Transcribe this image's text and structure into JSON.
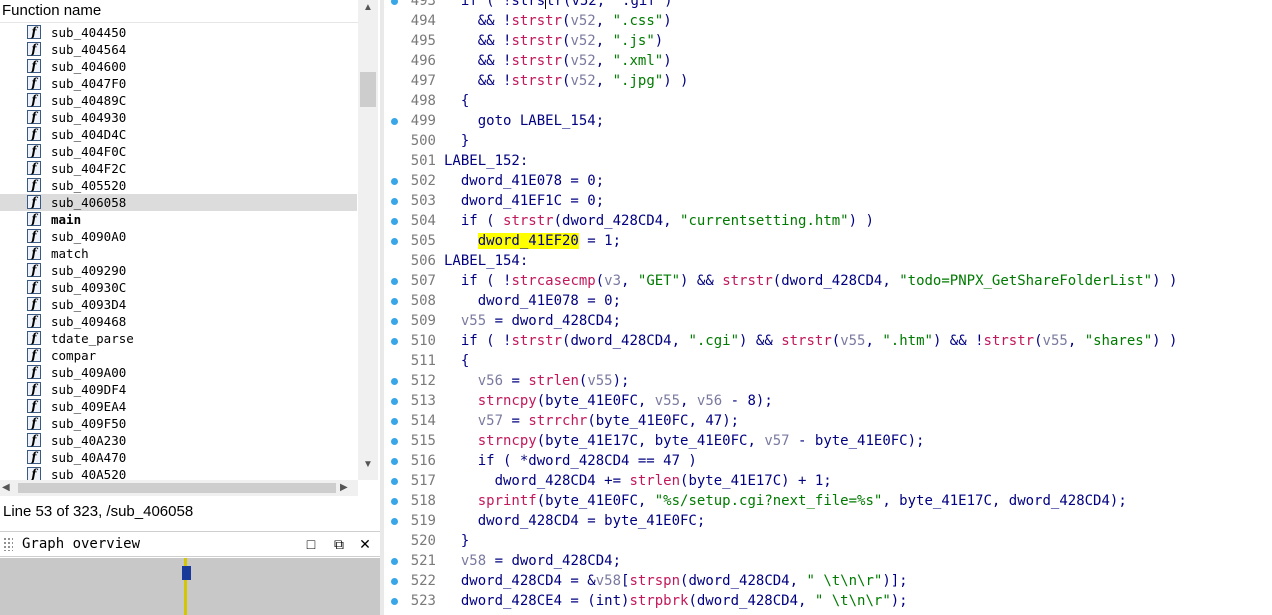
{
  "functions_window": {
    "header": "Function name",
    "items": [
      {
        "name": "sub_404450"
      },
      {
        "name": "sub_404564"
      },
      {
        "name": "sub_404600"
      },
      {
        "name": "sub_4047F0"
      },
      {
        "name": "sub_40489C"
      },
      {
        "name": "sub_404930"
      },
      {
        "name": "sub_404D4C"
      },
      {
        "name": "sub_404F0C"
      },
      {
        "name": "sub_404F2C"
      },
      {
        "name": "sub_405520"
      },
      {
        "name": "sub_406058",
        "selected": true
      },
      {
        "name": "main",
        "bold": true
      },
      {
        "name": "sub_4090A0"
      },
      {
        "name": "match"
      },
      {
        "name": "sub_409290"
      },
      {
        "name": "sub_40930C"
      },
      {
        "name": "sub_4093D4"
      },
      {
        "name": "sub_409468"
      },
      {
        "name": "tdate_parse"
      },
      {
        "name": "compar"
      },
      {
        "name": "sub_409A00"
      },
      {
        "name": "sub_409DF4"
      },
      {
        "name": "sub_409EA4"
      },
      {
        "name": "sub_409F50"
      },
      {
        "name": "sub_40A230"
      },
      {
        "name": "sub_40A470"
      },
      {
        "name": "sub_40A520"
      }
    ],
    "icon_glyph": "f"
  },
  "status_line": "Line 53 of 323, /sub_406058",
  "graph_overview": {
    "title": "Graph overview",
    "buttons": [
      "□",
      "⧉",
      "✕"
    ]
  },
  "pseudocode": {
    "lines": [
      {
        "no": "493",
        "bp": true,
        "tokens": [
          [
            "p",
            "  if ( !strs"
          ],
          [
            "cursor",
            "t"
          ],
          [
            "p",
            "r(v52, \".gif\")"
          ]
        ]
      },
      {
        "no": "494",
        "bp": false,
        "tokens": [
          [
            "p",
            "    && !"
          ],
          [
            "fn",
            "strstr"
          ],
          [
            "p",
            "("
          ],
          [
            "var",
            "v52"
          ],
          [
            "p",
            ", "
          ],
          [
            "str",
            "\".css\""
          ],
          [
            "p",
            ")"
          ]
        ]
      },
      {
        "no": "495",
        "bp": false,
        "tokens": [
          [
            "p",
            "    && !"
          ],
          [
            "fn",
            "strstr"
          ],
          [
            "p",
            "("
          ],
          [
            "var",
            "v52"
          ],
          [
            "p",
            ", "
          ],
          [
            "str",
            "\".js\""
          ],
          [
            "p",
            ")"
          ]
        ]
      },
      {
        "no": "496",
        "bp": false,
        "tokens": [
          [
            "p",
            "    && !"
          ],
          [
            "fn",
            "strstr"
          ],
          [
            "p",
            "("
          ],
          [
            "var",
            "v52"
          ],
          [
            "p",
            ", "
          ],
          [
            "str",
            "\".xml\""
          ],
          [
            "p",
            ")"
          ]
        ]
      },
      {
        "no": "497",
        "bp": false,
        "tokens": [
          [
            "p",
            "    && !"
          ],
          [
            "fn",
            "strstr"
          ],
          [
            "p",
            "("
          ],
          [
            "var",
            "v52"
          ],
          [
            "p",
            ", "
          ],
          [
            "str",
            "\".jpg\""
          ],
          [
            "p",
            ") )"
          ]
        ]
      },
      {
        "no": "498",
        "bp": false,
        "tokens": [
          [
            "p",
            "  {"
          ]
        ]
      },
      {
        "no": "499",
        "bp": true,
        "tokens": [
          [
            "p",
            "    goto LABEL_154;"
          ]
        ]
      },
      {
        "no": "500",
        "bp": false,
        "tokens": [
          [
            "p",
            "  }"
          ]
        ]
      },
      {
        "no": "501",
        "bp": false,
        "tokens": [
          [
            "p",
            "LABEL_152:"
          ]
        ]
      },
      {
        "no": "502",
        "bp": true,
        "tokens": [
          [
            "p",
            "  dword_41E078 = 0;"
          ]
        ]
      },
      {
        "no": "503",
        "bp": true,
        "tokens": [
          [
            "p",
            "  dword_41EF1C = 0;"
          ]
        ]
      },
      {
        "no": "504",
        "bp": true,
        "tokens": [
          [
            "p",
            "  if ( "
          ],
          [
            "fn",
            "strstr"
          ],
          [
            "p",
            "(dword_428CD4, "
          ],
          [
            "str",
            "\"currentsetting.htm\""
          ],
          [
            "p",
            ") )"
          ]
        ]
      },
      {
        "no": "505",
        "bp": true,
        "tokens": [
          [
            "p",
            "    "
          ],
          [
            "hl",
            "dword_41EF20"
          ],
          [
            "p",
            " = 1;"
          ]
        ]
      },
      {
        "no": "506",
        "bp": false,
        "tokens": [
          [
            "p",
            "LABEL_154:"
          ]
        ]
      },
      {
        "no": "507",
        "bp": true,
        "tokens": [
          [
            "p",
            "  if ( !"
          ],
          [
            "fn",
            "strcasecmp"
          ],
          [
            "p",
            "("
          ],
          [
            "var",
            "v3"
          ],
          [
            "p",
            ", "
          ],
          [
            "str",
            "\"GET\""
          ],
          [
            "p",
            ") && "
          ],
          [
            "fn",
            "strstr"
          ],
          [
            "p",
            "(dword_428CD4, "
          ],
          [
            "str",
            "\"todo=PNPX_GetShareFolderList\""
          ],
          [
            "p",
            ") )"
          ]
        ]
      },
      {
        "no": "508",
        "bp": true,
        "tokens": [
          [
            "p",
            "    dword_41E078 = 0;"
          ]
        ]
      },
      {
        "no": "509",
        "bp": true,
        "tokens": [
          [
            "p",
            "  "
          ],
          [
            "var",
            "v55"
          ],
          [
            "p",
            " = dword_428CD4;"
          ]
        ]
      },
      {
        "no": "510",
        "bp": true,
        "tokens": [
          [
            "p",
            "  if ( !"
          ],
          [
            "fn",
            "strstr"
          ],
          [
            "p",
            "(dword_428CD4, "
          ],
          [
            "str",
            "\".cgi\""
          ],
          [
            "p",
            ") && "
          ],
          [
            "fn",
            "strstr"
          ],
          [
            "p",
            "("
          ],
          [
            "var",
            "v55"
          ],
          [
            "p",
            ", "
          ],
          [
            "str",
            "\".htm\""
          ],
          [
            "p",
            ") && !"
          ],
          [
            "fn",
            "strstr"
          ],
          [
            "p",
            "("
          ],
          [
            "var",
            "v55"
          ],
          [
            "p",
            ", "
          ],
          [
            "str",
            "\"shares\""
          ],
          [
            "p",
            ") )"
          ]
        ]
      },
      {
        "no": "511",
        "bp": false,
        "tokens": [
          [
            "p",
            "  {"
          ]
        ]
      },
      {
        "no": "512",
        "bp": true,
        "tokens": [
          [
            "p",
            "    "
          ],
          [
            "var",
            "v56"
          ],
          [
            "p",
            " = "
          ],
          [
            "fn",
            "strlen"
          ],
          [
            "p",
            "("
          ],
          [
            "var",
            "v55"
          ],
          [
            "p",
            ");"
          ]
        ]
      },
      {
        "no": "513",
        "bp": true,
        "tokens": [
          [
            "p",
            "    "
          ],
          [
            "fn",
            "strncpy"
          ],
          [
            "p",
            "(byte_41E0FC, "
          ],
          [
            "var",
            "v55"
          ],
          [
            "p",
            ", "
          ],
          [
            "var",
            "v56"
          ],
          [
            "p",
            " - 8);"
          ]
        ]
      },
      {
        "no": "514",
        "bp": true,
        "tokens": [
          [
            "p",
            "    "
          ],
          [
            "var",
            "v57"
          ],
          [
            "p",
            " = "
          ],
          [
            "fn",
            "strrchr"
          ],
          [
            "p",
            "(byte_41E0FC, 47);"
          ]
        ]
      },
      {
        "no": "515",
        "bp": true,
        "tokens": [
          [
            "p",
            "    "
          ],
          [
            "fn",
            "strncpy"
          ],
          [
            "p",
            "(byte_41E17C, byte_41E0FC, "
          ],
          [
            "var",
            "v57"
          ],
          [
            "p",
            " - byte_41E0FC);"
          ]
        ]
      },
      {
        "no": "516",
        "bp": true,
        "tokens": [
          [
            "p",
            "    if ( *dword_428CD4 == 47 )"
          ]
        ]
      },
      {
        "no": "517",
        "bp": true,
        "tokens": [
          [
            "p",
            "      dword_428CD4 += "
          ],
          [
            "fn",
            "strlen"
          ],
          [
            "p",
            "(byte_41E17C) + 1;"
          ]
        ]
      },
      {
        "no": "518",
        "bp": true,
        "tokens": [
          [
            "p",
            "    "
          ],
          [
            "fn",
            "sprintf"
          ],
          [
            "p",
            "(byte_41E0FC, "
          ],
          [
            "str",
            "\"%s/setup.cgi?next_file=%s\""
          ],
          [
            "p",
            ", byte_41E17C, dword_428CD4);"
          ]
        ]
      },
      {
        "no": "519",
        "bp": true,
        "tokens": [
          [
            "p",
            "    dword_428CD4 = byte_41E0FC;"
          ]
        ]
      },
      {
        "no": "520",
        "bp": false,
        "tokens": [
          [
            "p",
            "  }"
          ]
        ]
      },
      {
        "no": "521",
        "bp": true,
        "tokens": [
          [
            "p",
            "  "
          ],
          [
            "var",
            "v58"
          ],
          [
            "p",
            " = dword_428CD4;"
          ]
        ]
      },
      {
        "no": "522",
        "bp": true,
        "tokens": [
          [
            "p",
            "  dword_428CD4 = &"
          ],
          [
            "var",
            "v58"
          ],
          [
            "p",
            "["
          ],
          [
            "fn",
            "strspn"
          ],
          [
            "p",
            "(dword_428CD4, "
          ],
          [
            "str",
            "\" \\t\\n\\r\""
          ],
          [
            "p",
            ")];"
          ]
        ]
      },
      {
        "no": "523",
        "bp": true,
        "tokens": [
          [
            "p",
            "  dword_428CE4 = (int)"
          ],
          [
            "fn",
            "strpbrk"
          ],
          [
            "p",
            "(dword_428CD4, "
          ],
          [
            "str",
            "\" \\t\\n\\r\""
          ],
          [
            "p",
            ");"
          ]
        ]
      }
    ]
  },
  "colors": {
    "keyword_plain": "#000080",
    "function": "#c2185b",
    "string": "#007a00",
    "local_var": "#7a7aa0",
    "highlight": "#ffff00",
    "breakpoint_dot": "#39a6e8",
    "selected_row": "#dcdcdc"
  }
}
